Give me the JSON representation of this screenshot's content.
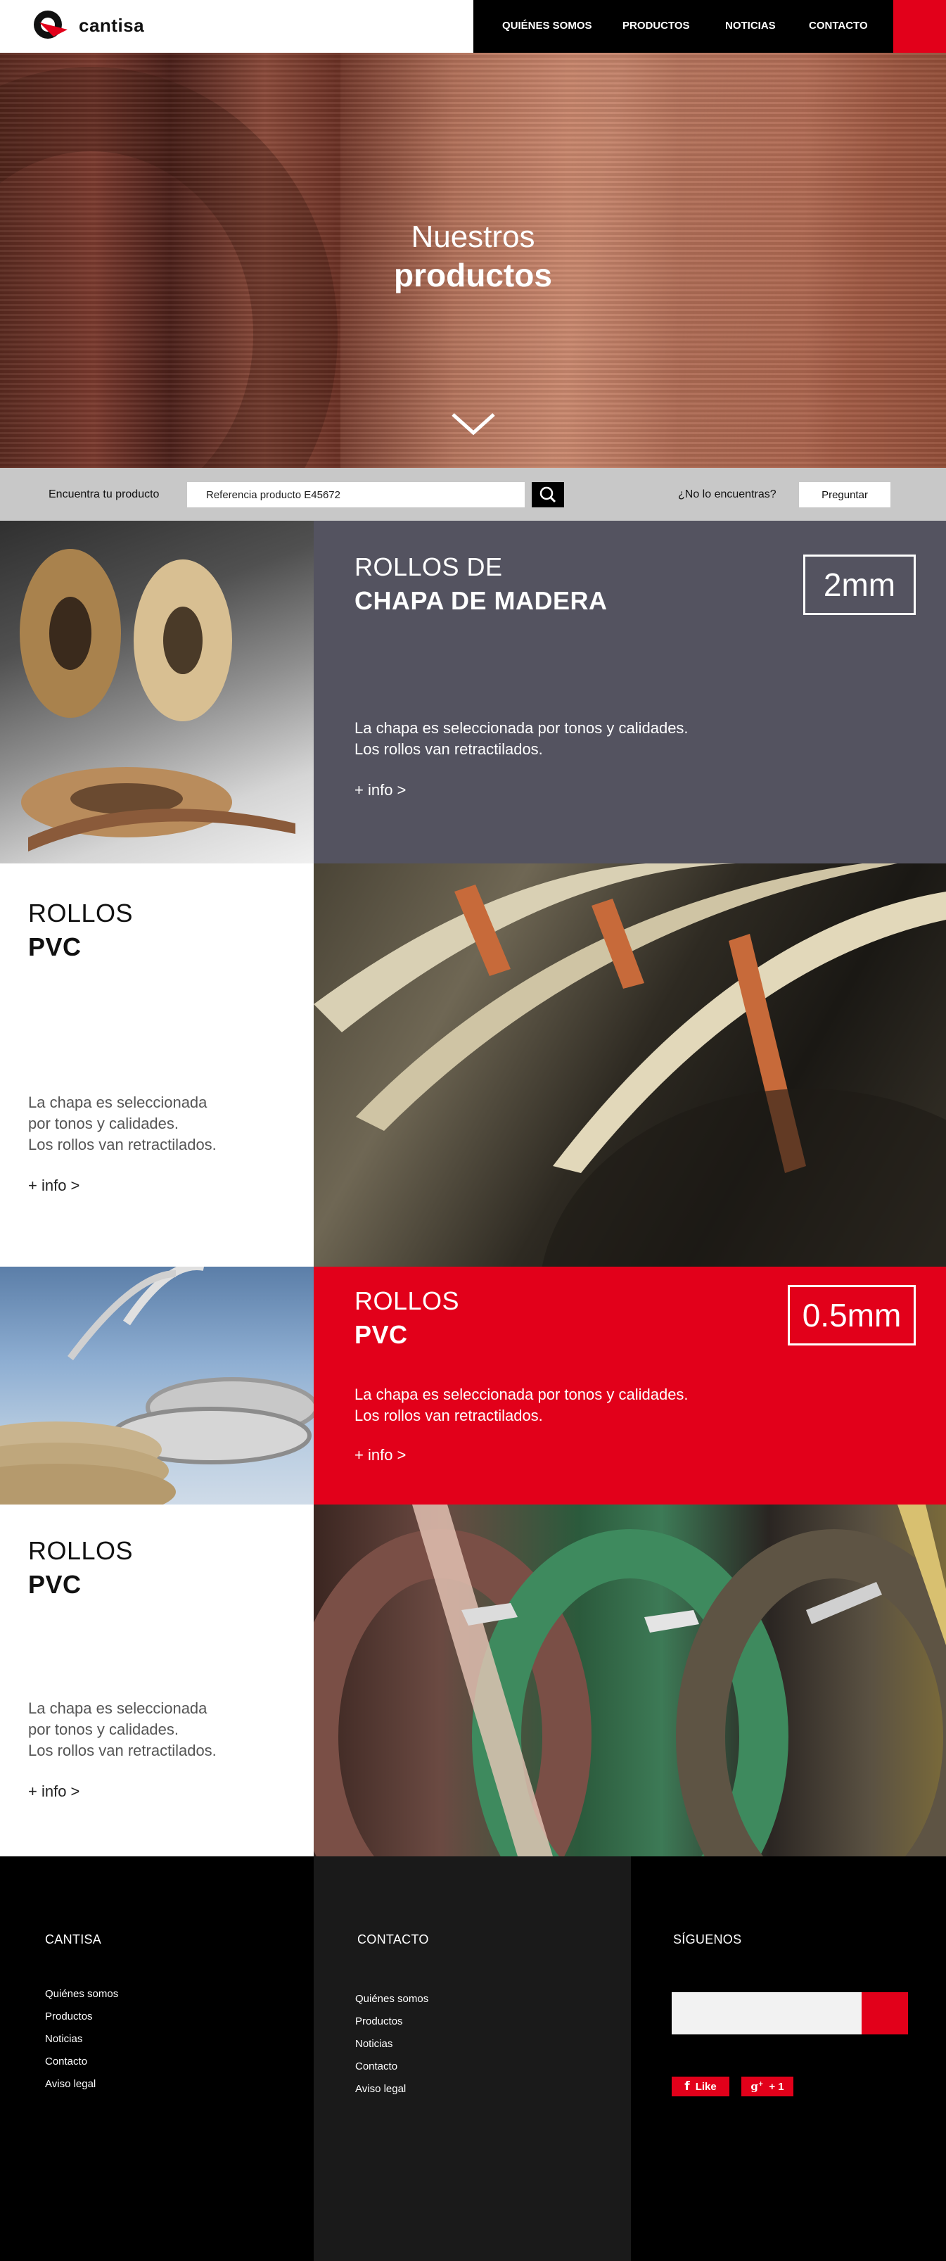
{
  "brand": {
    "name": "cantisa",
    "accent": "#e2001a"
  },
  "nav": {
    "items": [
      "QUIÉNES SOMOS",
      "PRODUCTOS",
      "NOTICIAS",
      "CONTACTO"
    ]
  },
  "hero": {
    "line1": "Nuestros",
    "line2": "productos",
    "scroll_icon": "chevron-down-icon"
  },
  "search": {
    "label": "Encuentra tu producto",
    "value": "Referencia producto E45672",
    "button_icon": "search-icon",
    "ask_label": "¿No lo encuentras?",
    "ask_button": "Preguntar"
  },
  "products": [
    {
      "title1": "ROLLOS DE",
      "title2": "CHAPA DE MADERA",
      "badge": "2mm",
      "desc": "La chapa es seleccionada por tonos y calidades.\nLos rollos van retractilados.",
      "info": "+ info >",
      "bg": "#545360"
    },
    {
      "title1": "ROLLOS",
      "title2": "PVC",
      "badge": "",
      "desc": "La chapa es seleccionada\npor tonos y calidades.\nLos rollos van retractilados.",
      "info": "+ info >",
      "bg": "#ffffff"
    },
    {
      "title1": "ROLLOS",
      "title2": "PVC",
      "badge": "0.5mm",
      "desc": "La chapa es seleccionada por tonos y calidades.\nLos rollos van retractilados.",
      "info": "+ info >",
      "bg": "#e2001a"
    },
    {
      "title1": "ROLLOS",
      "title2": "PVC",
      "badge": "",
      "desc": "La chapa es seleccionada\npor tonos y calidades.\nLos rollos van retractilados.",
      "info": "+ info >",
      "bg": "#ffffff"
    }
  ],
  "footer": {
    "col1": {
      "heading": "CANTISA",
      "links": [
        "Quiénes somos",
        "Productos",
        "Noticias",
        "Contacto",
        "Aviso legal"
      ]
    },
    "col2": {
      "heading": "CONTACTO",
      "links": [
        "Quiénes somos",
        "Productos",
        "Noticias",
        "Contacto",
        "Aviso legal"
      ]
    },
    "col3": {
      "heading": "SÍGUENOS",
      "like": "Like",
      "plus": "+ 1",
      "facebook_icon": "facebook-icon",
      "gplus_icon": "google-plus-icon"
    }
  }
}
